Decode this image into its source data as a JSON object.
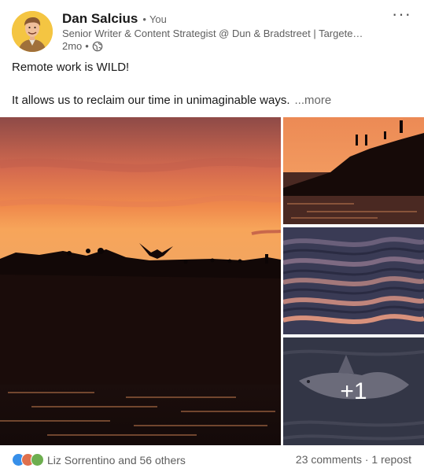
{
  "author": {
    "name": "Dan Salcius",
    "relation": "You",
    "headline": "Senior Writer & Content Strategist @ Dun & Bradstreet | Targete…",
    "time": "2mo"
  },
  "post": {
    "line1": "Remote work is WILD!",
    "line2": "It allows us to reclaim our time in unimaginable ways.",
    "see_more": "...more"
  },
  "images": {
    "extra_count": "+1"
  },
  "social": {
    "reactions": [
      "like-icon",
      "love-icon",
      "support-icon"
    ],
    "reactors": "Liz Sorrentino and 56 others",
    "comments": "23 comments",
    "reposts": "1 repost"
  },
  "colors": {
    "like": "#378fe9",
    "love": "#df704d",
    "support": "#6dae4f"
  }
}
